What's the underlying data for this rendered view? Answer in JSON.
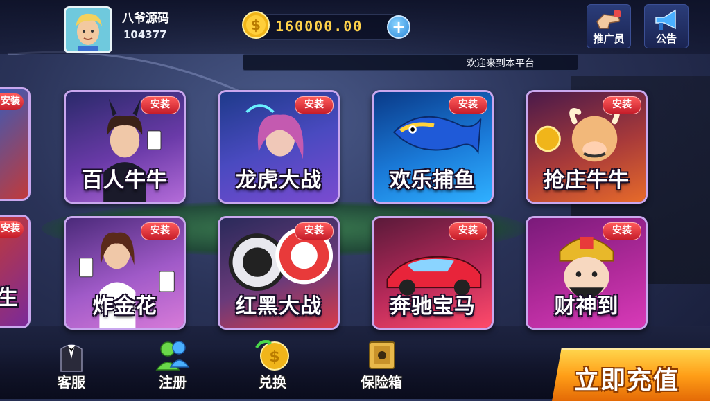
{
  "header": {
    "username": "八爷源码",
    "user_id": "104377",
    "coins": "160000.00"
  },
  "top_buttons": [
    {
      "label": "推广员",
      "icon": "promoter-hand-icon"
    },
    {
      "label": "公告",
      "icon": "megaphone-icon"
    }
  ],
  "marquee": {
    "text": "欢迎来到本平台"
  },
  "install_label": "安装",
  "edge_cards": [
    {
      "title_fragment": ""
    },
    {
      "title_fragment": "生"
    }
  ],
  "games": [
    {
      "title": "百人牛牛",
      "colors": [
        "#3a2a6a",
        "#b36bd8"
      ]
    },
    {
      "title": "龙虎大战",
      "colors": [
        "#1e3a8a",
        "#7a4bd0"
      ]
    },
    {
      "title": "欢乐捕鱼",
      "colors": [
        "#0a4aa8",
        "#2fb0ff"
      ]
    },
    {
      "title": "抢庄牛牛",
      "colors": [
        "#7a2a2a",
        "#e66a2a"
      ]
    },
    {
      "title": "炸金花",
      "colors": [
        "#4b2a7a",
        "#d77ad8"
      ]
    },
    {
      "title": "红黑大战",
      "colors": [
        "#2a2a5a",
        "#d83a4a"
      ]
    },
    {
      "title": "奔驰宝马",
      "colors": [
        "#5a1a3a",
        "#ff4a6a"
      ]
    },
    {
      "title": "财神到",
      "colors": [
        "#7a1a7a",
        "#d83ab8"
      ]
    }
  ],
  "bottom_nav": [
    {
      "label": "客服",
      "icon": "customer-service-tuxedo-icon"
    },
    {
      "label": "注册",
      "icon": "register-users-icon"
    },
    {
      "label": "兑换",
      "icon": "exchange-coin-icon"
    },
    {
      "label": "保险箱",
      "icon": "safe-box-icon"
    }
  ],
  "recharge_label": "立即充值"
}
